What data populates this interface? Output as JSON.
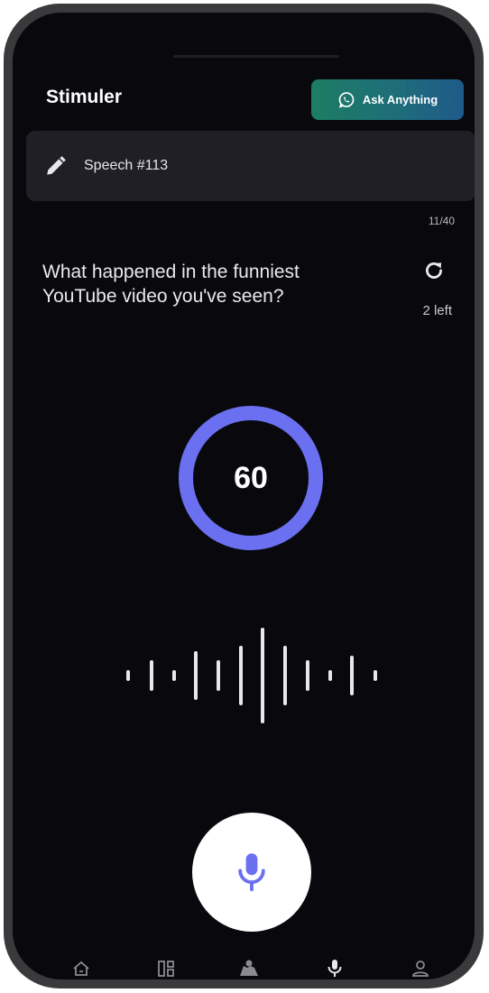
{
  "app": {
    "title": "Stimuler",
    "ask_button_label": "Ask Anything"
  },
  "speech": {
    "label": "Speech #113"
  },
  "question": {
    "progress": "11/40",
    "text": "What happened in the funniest YouTube video you've seen?",
    "refresh_left": "2 left"
  },
  "timer": {
    "value": "60",
    "ring_color": "#6a70f0"
  },
  "icons": {
    "ask": "whatsapp-icon",
    "edit": "pencil-icon",
    "refresh": "refresh-icon",
    "mic": "microphone-icon"
  },
  "nav": {
    "items": [
      {
        "name": "home-icon"
      },
      {
        "name": "dashboard-icon"
      },
      {
        "name": "map-icon"
      },
      {
        "name": "microphone-icon"
      },
      {
        "name": "profile-icon"
      }
    ]
  },
  "colors": {
    "accent": "#6a70f0",
    "ask_gradient_start": "#1c7d63",
    "ask_gradient_end": "#1e5a8a",
    "background": "#09090d"
  }
}
